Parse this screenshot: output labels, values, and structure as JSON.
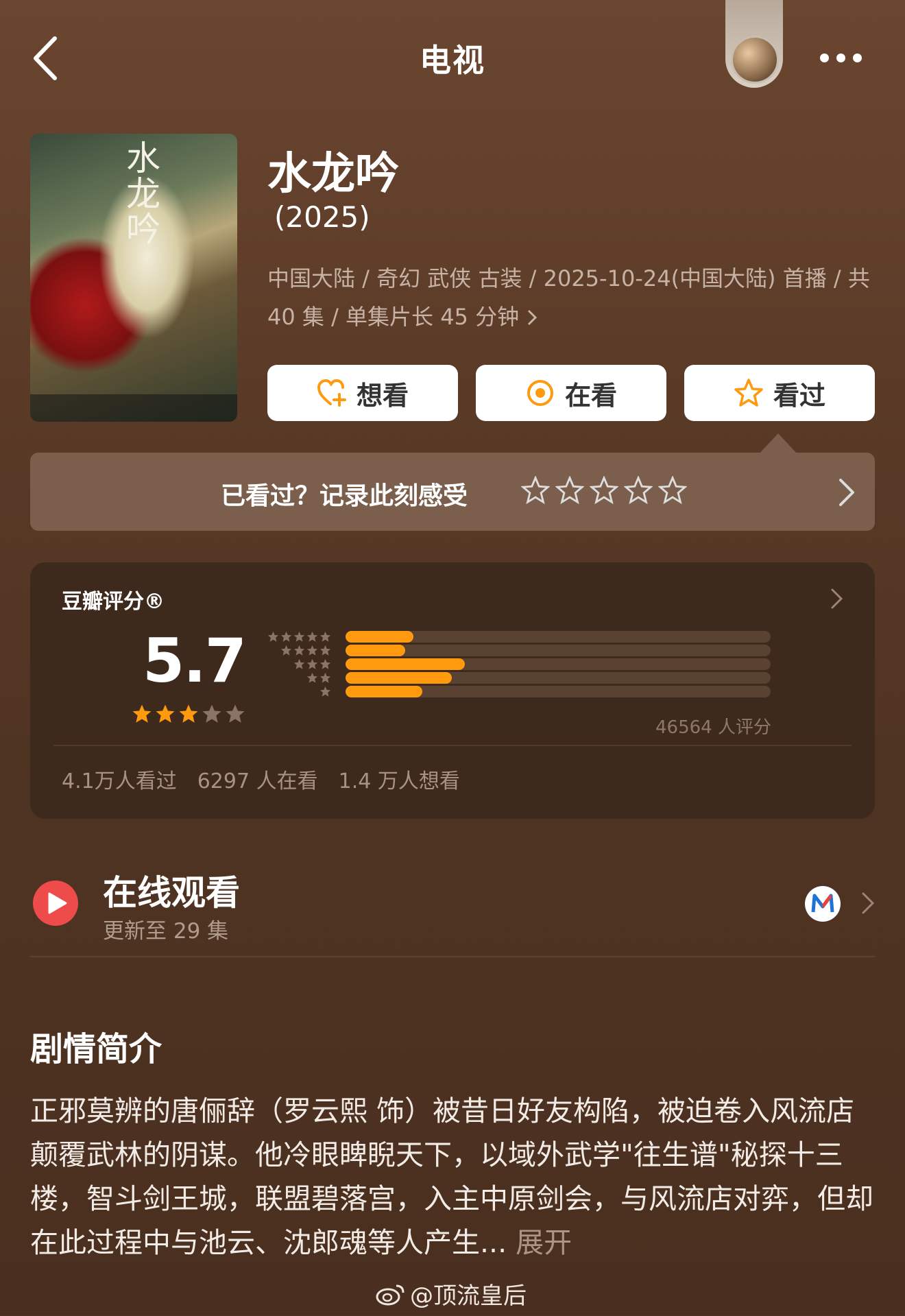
{
  "header": {
    "title": "电视"
  },
  "show": {
    "title": "水龙吟",
    "year": " (2025)",
    "meta": "中国大陆 / 奇幻 武侠 古装 / 2025-10-24(中国大陆) 首播 / 共 40 集 / 单集片长 45 分钟",
    "poster_title": "水龙吟"
  },
  "actions": {
    "want": "想看",
    "watching": "在看",
    "watched": "看过"
  },
  "record": {
    "prompt": "已看过？记录此刻感受"
  },
  "rating": {
    "label": "豆瓣评分®",
    "score": "5.7",
    "stars_filled": 3,
    "distribution_fraction": [
      0.16,
      0.14,
      0.28,
      0.25,
      0.18
    ],
    "count": "46564 人评分",
    "stats": [
      "4.1万人看过",
      "6297 人在看",
      "1.4 万人想看"
    ]
  },
  "online": {
    "title": "在线观看",
    "subtitle": "更新至 29 集",
    "platform_icon": "mango-tv-icon"
  },
  "synopsis": {
    "heading": "剧情简介",
    "text": "正邪莫辨的唐俪辞（罗云熙 饰）被昔日好友构陷，被迫卷入风流店颠覆武林的阴谋。他冷眼睥睨天下，以域外武学\"往生谱\"秘探十三楼，智斗剑王城，联盟碧落宫，入主中原剑会，与风流店对弈，但却在此过程中与池云、沈郎魂等人产生...",
    "expand": " 展开"
  },
  "watermark": "@顶流皇后",
  "colors": {
    "accent": "#ff9a0e",
    "play": "#ee4b4b",
    "background": "#5a3a27"
  }
}
